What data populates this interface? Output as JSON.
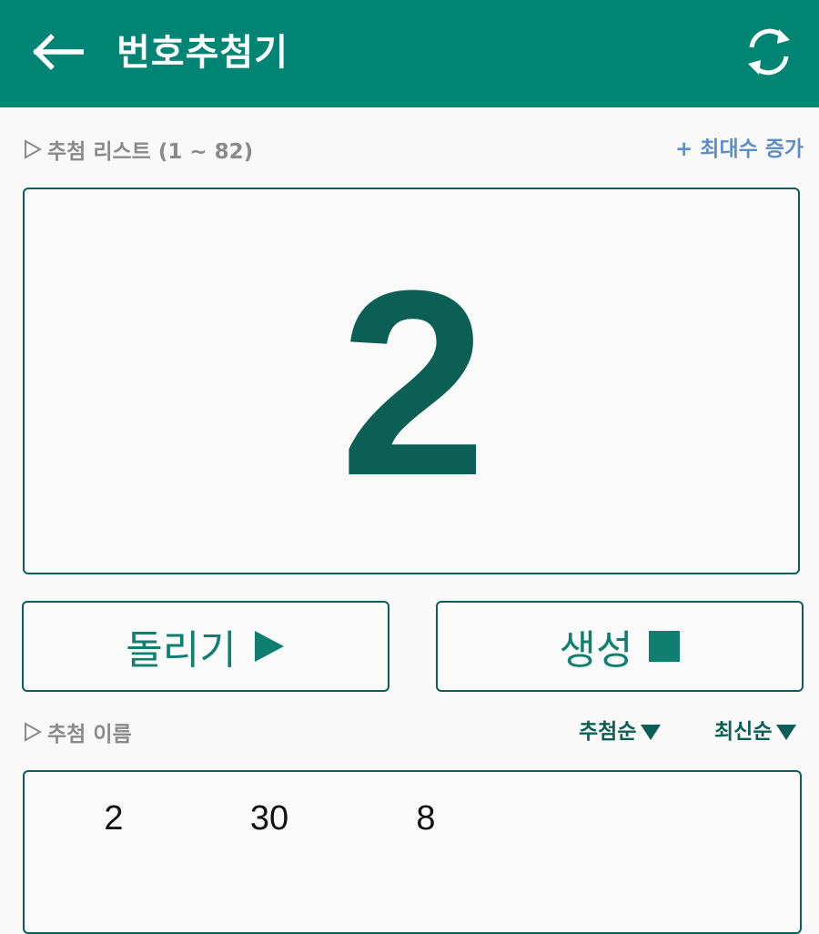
{
  "appbar": {
    "title": "번호추첨기",
    "back_icon": "arrow-left-icon",
    "refresh_icon": "refresh-icon",
    "background": "#008473"
  },
  "draw_list": {
    "label": "추첨 리스트 (1 ~ 82)",
    "increase_max_label": "+ 최대수 증가"
  },
  "display": {
    "current_number": "2"
  },
  "actions": {
    "spin_label": "돌리기",
    "spin_icon": "play-icon",
    "generate_label": "생성",
    "generate_icon": "stop-icon"
  },
  "names": {
    "label": "추첨 이름",
    "sort_draw_label": "추첨순",
    "sort_recent_label": "최신순"
  },
  "results": [
    "2",
    "30",
    "8"
  ],
  "colors": {
    "accent": "#008473",
    "dark_green": "#0b5f55",
    "link_blue": "#5d8ec6"
  }
}
